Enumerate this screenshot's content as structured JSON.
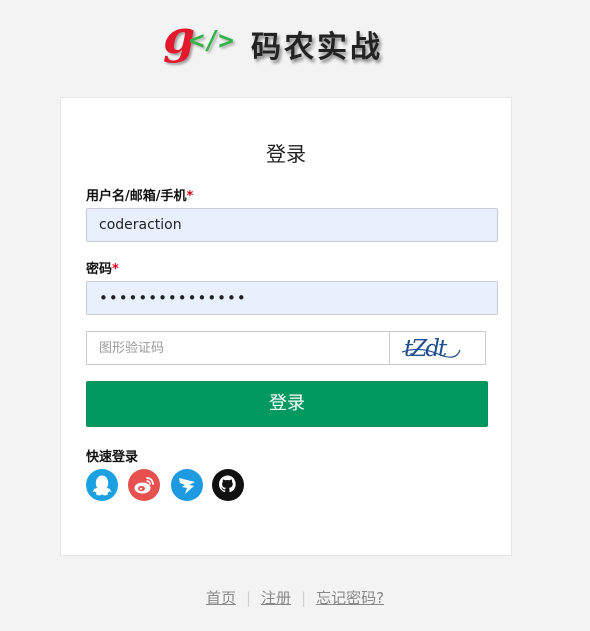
{
  "logo": {
    "g": "g",
    "tag": "</>",
    "name": "码农实战"
  },
  "login": {
    "title": "登录",
    "username_label": "用户名/邮箱/手机",
    "username_value": "coderaction",
    "password_label": "密码",
    "password_mask": "•••••••••••••••",
    "required_mark": "*",
    "captcha_placeholder": "图形验证码",
    "captcha_text": "tZdt",
    "submit_label": "登录",
    "quick_login_label": "快速登录",
    "social": [
      {
        "name": "qq",
        "icon": "qq-icon",
        "color": "#1ba1e2"
      },
      {
        "name": "weibo",
        "icon": "weibo-icon",
        "color": "#e6514f"
      },
      {
        "name": "dingtalk",
        "icon": "dingtalk-icon",
        "color": "#1e9be0"
      },
      {
        "name": "github",
        "icon": "github-icon",
        "color": "#111111"
      }
    ]
  },
  "footer": {
    "home": "首页",
    "register": "注册",
    "forgot": "忘记密码?"
  },
  "colors": {
    "primary": "#009a61",
    "required": "#d0021b",
    "input_bg": "#e8f0fe",
    "page_bg": "#f3f3f3"
  }
}
